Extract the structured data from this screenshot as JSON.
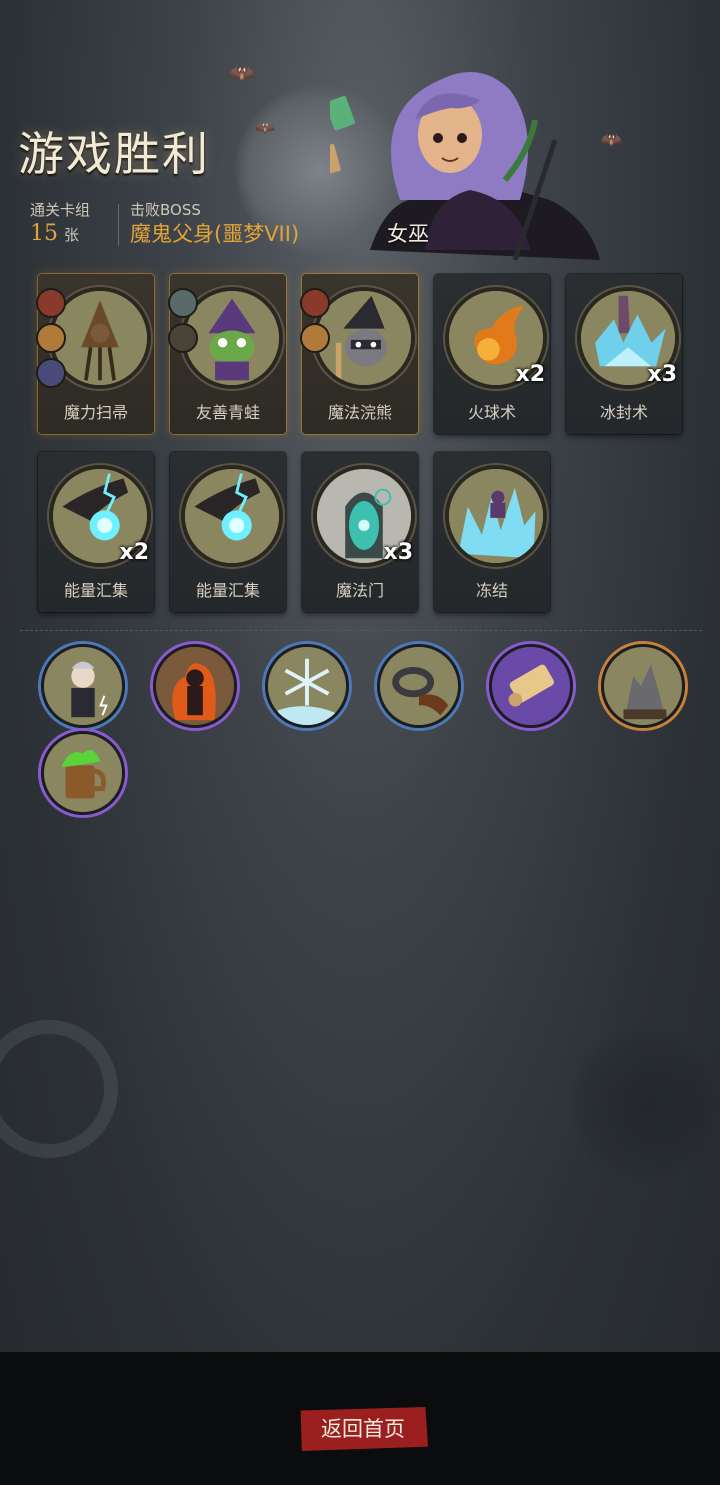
{
  "header": {
    "title": "游戏胜利",
    "deck_label": "通关卡组",
    "deck_count": "15",
    "deck_unit": "张",
    "boss_label": "击败BOSS",
    "boss_name": "魔鬼父身(噩梦VII)",
    "hero_name": "女巫"
  },
  "cards": [
    {
      "name": "魔力扫帚",
      "count": "",
      "color": "#8a8660"
    },
    {
      "name": "友善青蛙",
      "count": "",
      "color": "#8a8660"
    },
    {
      "name": "魔法浣熊",
      "count": "",
      "color": "#8a8660"
    },
    {
      "name": "火球术",
      "count": "x2",
      "color": "#e07a1a"
    },
    {
      "name": "冰封术",
      "count": "x3",
      "color": "#6fd0ec"
    },
    {
      "name": "能量汇集",
      "count": "x2",
      "color": "#6ff0ff"
    },
    {
      "name": "能量汇集",
      "count": "",
      "color": "#6ff0ff"
    },
    {
      "name": "魔法门",
      "count": "x3",
      "color": "#3ec0b0"
    },
    {
      "name": "冻结",
      "count": "",
      "color": "#7fdcf2"
    }
  ],
  "relics": [
    {
      "icon": "girl-with-lightning-icon",
      "ring": "#4e79b8"
    },
    {
      "icon": "fire-figure-icon",
      "ring": "#8a5bd0"
    },
    {
      "icon": "snowflake-icon",
      "ring": "#4e79b8"
    },
    {
      "icon": "ring-icon",
      "ring": "#4e79b8"
    },
    {
      "icon": "scroll-icon",
      "ring": "#8a5bd0"
    },
    {
      "icon": "broken-statue-icon",
      "ring": "#c9813a"
    },
    {
      "icon": "potion-mug-icon",
      "ring": "#8a5bd0"
    }
  ],
  "footer": {
    "home_button": "返回首页"
  },
  "colors": {
    "accent_gold": "#e3a437",
    "button_red": "#9b1f1f",
    "rarity_blue": "#4e79b8",
    "rarity_purple": "#8a5bd0",
    "rarity_orange": "#c9813a"
  }
}
